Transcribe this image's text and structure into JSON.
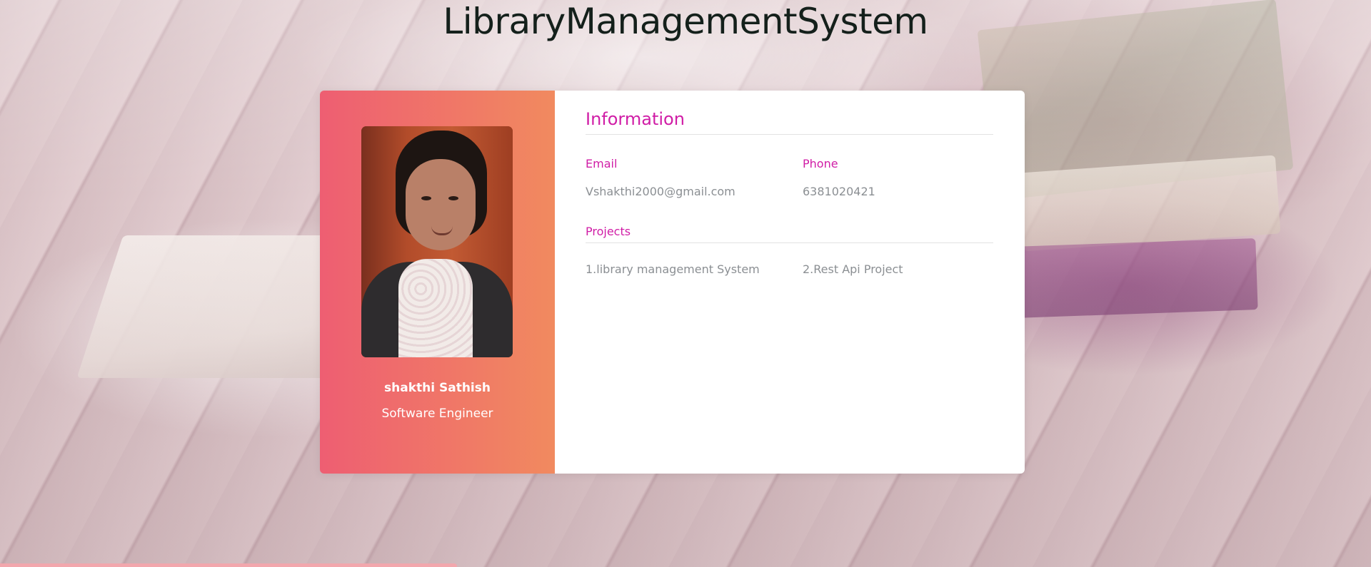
{
  "header": {
    "title": "LibraryManagementSystem"
  },
  "profile": {
    "name": "shakthi Sathish",
    "role": "Software Engineer",
    "photo_alt": "profile-photo"
  },
  "info": {
    "section_title": "Information",
    "email_label": "Email",
    "email_value": "Vshakthi2000@gmail.com",
    "phone_label": "Phone",
    "phone_value": "6381020421",
    "projects_label": "Projects",
    "projects": [
      "1.library management System",
      "2.Rest Api Project"
    ]
  },
  "colors": {
    "accent": "#d01da6",
    "gradient_start": "#ee5e72",
    "gradient_end": "#f18a5f",
    "value_text": "#8b8f93"
  }
}
